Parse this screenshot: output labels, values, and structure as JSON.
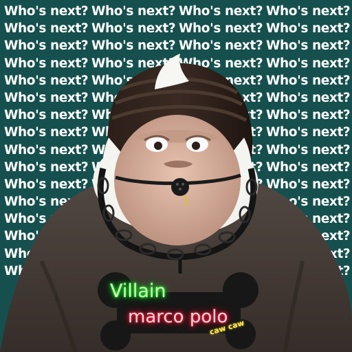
{
  "background": {
    "phrase": "Who's next?",
    "rows": 16,
    "columns": 4,
    "color": "#16504e",
    "text_color": "#ffffff"
  },
  "character": {
    "hood_color": "#241914",
    "coat_color": "#463d37",
    "fur_color": "#f4f4f0",
    "face_color": "#dcb5a2",
    "chain_color": "#141414",
    "gag_color": "#1a1a1a"
  },
  "badge": {
    "title": "Villain",
    "name": "marco polo",
    "sticker": "caw caw",
    "title_glow": "#22ff33",
    "name_glow": "#ff2a4a"
  }
}
